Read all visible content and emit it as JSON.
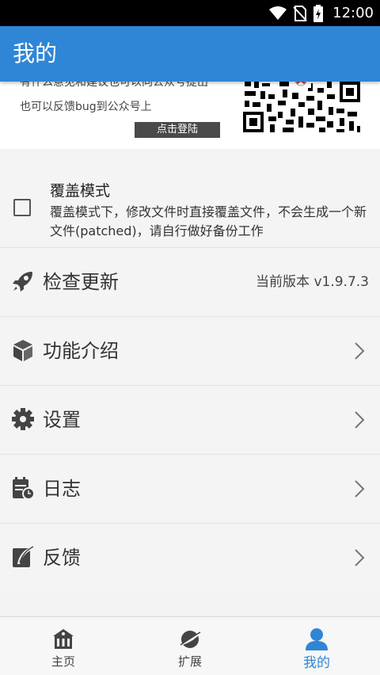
{
  "status_bar": {
    "time": "12:00"
  },
  "app_bar": {
    "title": "我的"
  },
  "banner": {
    "line1": "有什么意见和建议也可以向公众号提出",
    "line2": "也可以反馈bug到公众号上",
    "login_label": "点击登陆"
  },
  "overlay_mode": {
    "title": "覆盖模式",
    "description": "覆盖模式下，修改文件时直接覆盖文件，不会生成一个新文件(patched)，请自行做好备份工作",
    "checked": false
  },
  "menu": {
    "check_update": {
      "label": "检查更新",
      "value": "当前版本 v1.9.7.3",
      "icon": "rocket-icon"
    },
    "features": {
      "label": "功能介绍",
      "icon": "cube-icon"
    },
    "settings": {
      "label": "设置",
      "icon": "gear-icon"
    },
    "log": {
      "label": "日志",
      "icon": "calendar-clock-icon"
    },
    "feedback": {
      "label": "反馈",
      "icon": "feather-icon"
    }
  },
  "bottom_nav": {
    "items": [
      {
        "label": "主页",
        "icon": "home-icon"
      },
      {
        "label": "扩展",
        "icon": "planet-icon"
      },
      {
        "label": "我的",
        "icon": "person-icon"
      }
    ],
    "active_index": 2,
    "active_color": "#2f86d6"
  },
  "colors": {
    "primary": "#2f86d6"
  }
}
